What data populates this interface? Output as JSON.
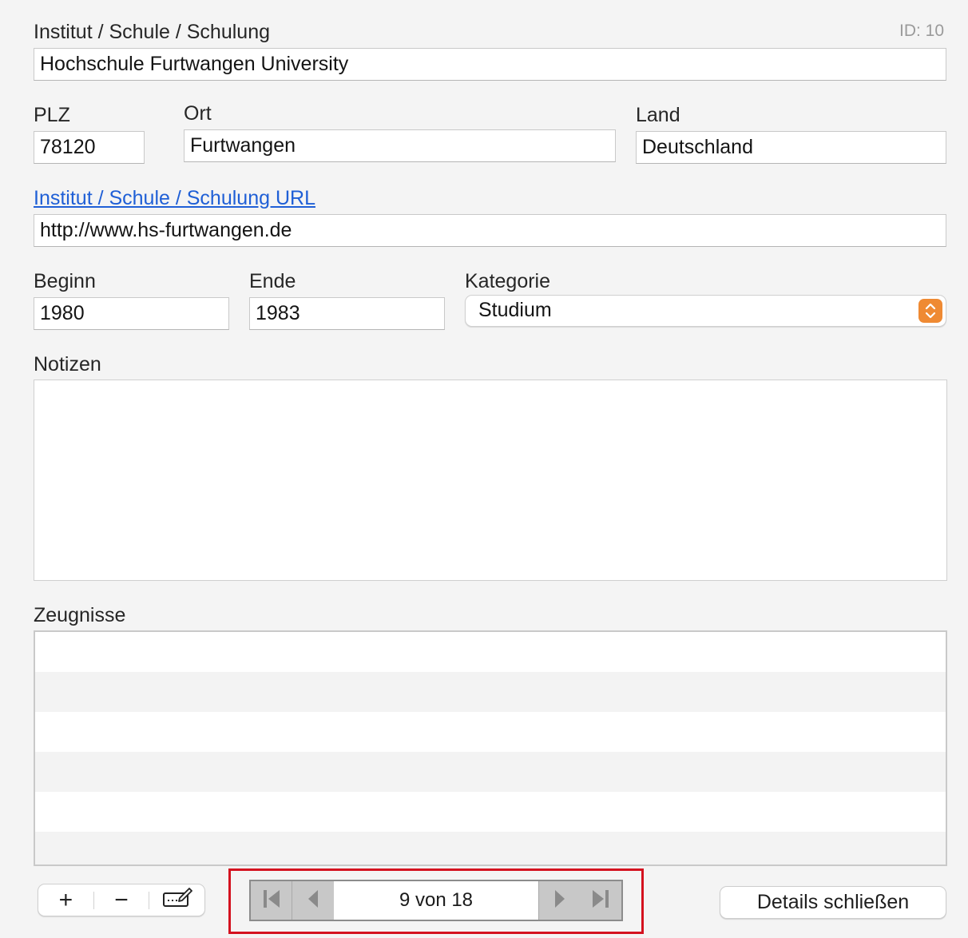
{
  "record": {
    "id_label": "ID: 10"
  },
  "institution": {
    "label": "Institut / Schule / Schulung",
    "value": "Hochschule Furtwangen University"
  },
  "address": {
    "plz_label": "PLZ",
    "plz_value": "78120",
    "ort_label": "Ort",
    "ort_value": "Furtwangen",
    "land_label": "Land",
    "land_value": "Deutschland"
  },
  "url": {
    "label": "Institut / Schule / Schulung URL",
    "value": "http://www.hs-furtwangen.de"
  },
  "period": {
    "beginn_label": "Beginn",
    "beginn_value": "1980",
    "ende_label": "Ende",
    "ende_value": "1983",
    "kategorie_label": "Kategorie",
    "kategorie_value": "Studium"
  },
  "notes": {
    "label": "Notizen",
    "value": ""
  },
  "certificates": {
    "label": "Zeugnisse",
    "rows": [
      "",
      "",
      "",
      "",
      "",
      ""
    ]
  },
  "toolbar": {
    "add_label": "+",
    "remove_label": "−"
  },
  "pager": {
    "count_text": "9 von 18",
    "current": 9,
    "total": 18
  },
  "actions": {
    "close_details_label": "Details schließen"
  },
  "colors": {
    "accent_select": "#ef8a33",
    "link": "#1f5fd6",
    "highlight": "#d4121f"
  }
}
